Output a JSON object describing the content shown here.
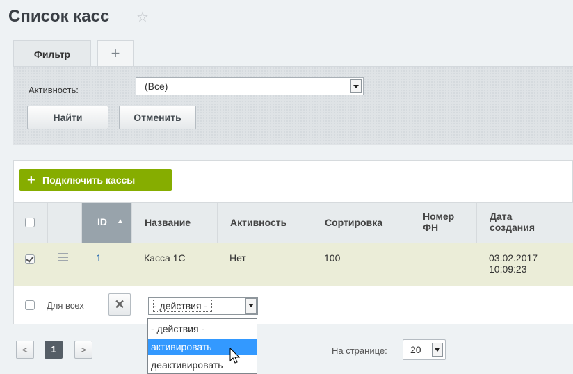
{
  "page": {
    "title": "Список касс"
  },
  "filter": {
    "tab_label": "Фильтр",
    "add_tab_label": "+",
    "activity_label": "Активность:",
    "activity_value": "(Все)",
    "find_button": "Найти",
    "cancel_button": "Отменить"
  },
  "toolbar": {
    "add_button": "Подключить кассы"
  },
  "table": {
    "columns": [
      "ID",
      "Название",
      "Активность",
      "Сортировка",
      "Номер ФН",
      "Дата создания"
    ],
    "rows": [
      {
        "checked": true,
        "id": "1",
        "name": "Касса 1С",
        "active": "Нет",
        "sort": "100",
        "fn_number": "",
        "created": "03.02.2017 10:09:23"
      }
    ]
  },
  "group_actions": {
    "for_all_label": "Для всех",
    "selected_action": "- действия -",
    "options": [
      "- действия -",
      "активировать",
      "деактивировать"
    ],
    "highlighted_option": "активировать"
  },
  "pagination": {
    "prev": "<",
    "current_page": "1",
    "next": ">",
    "per_page_label": "На странице:",
    "per_page_value": "20"
  }
}
